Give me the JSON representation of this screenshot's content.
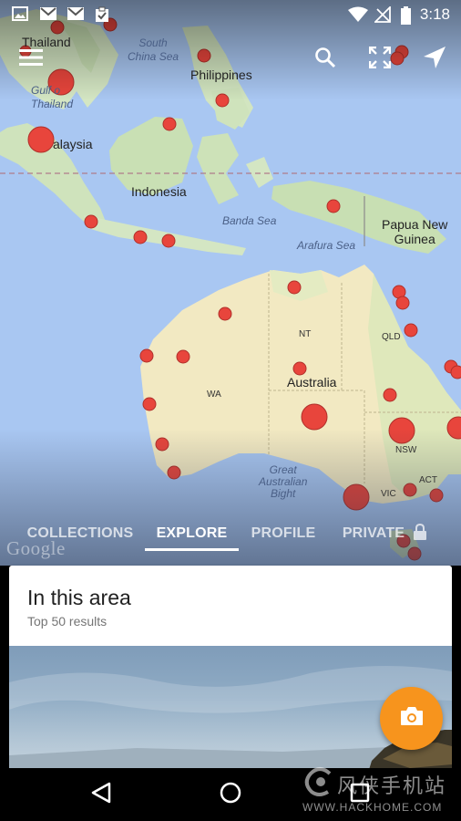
{
  "status_bar": {
    "time": "3:18",
    "left_icons": [
      "gallery-icon",
      "gmail-icon",
      "gmail-icon",
      "clipboard-check-icon"
    ],
    "right_icons": [
      "wifi-icon",
      "no-signal-icon",
      "battery-icon"
    ]
  },
  "toolbar": {
    "menu_icon": "menu-icon",
    "search_icon": "search-icon",
    "fullscreen_icon": "fullscreen-icon",
    "location_icon": "navigation-arrow-icon"
  },
  "map": {
    "labels": {
      "thailand": "Thailand",
      "gulf_thailand": "Gulf o\nThailand",
      "south_china_sea": "South\nChina Sea",
      "philippines": "Philippines",
      "malaysia": "alaysia",
      "indonesia": "Indonesia",
      "banda_sea": "Banda Sea",
      "arafura_sea": "Arafura Sea",
      "papua": "Papua New\nGuinea",
      "nt": "NT",
      "qld": "QLD",
      "wa": "WA",
      "australia": "Australia",
      "nsw": "NSW",
      "act": "ACT",
      "vic": "VIC",
      "bight": "Great\nAustralian\nBight",
      "google": "Google"
    },
    "marker_color": "#e8453c"
  },
  "tabs": [
    {
      "label": "COLLECTIONS",
      "active": false
    },
    {
      "label": "EXPLORE",
      "active": true
    },
    {
      "label": "PROFILE",
      "active": false
    },
    {
      "label": "PRIVATE",
      "active": false,
      "icon": "lock-icon"
    }
  ],
  "card": {
    "title": "In this area",
    "subtitle": "Top 50 results"
  },
  "fab": {
    "icon": "camera-icon",
    "color": "#f7941d"
  },
  "nav": {
    "back_icon": "back-triangle-icon",
    "home_icon": "home-circle-icon",
    "recents_icon": "recents-square-icon"
  },
  "watermark": {
    "text_cn": "风侠手机站",
    "url": "WWW.HACKHOME.COM"
  }
}
